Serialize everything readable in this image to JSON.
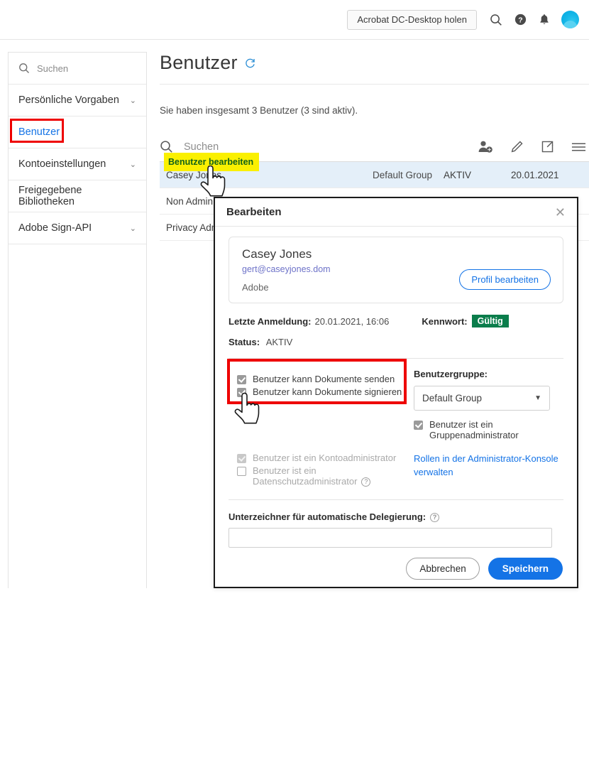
{
  "topbar": {
    "cta_label": "Acrobat DC-Desktop holen",
    "icons": [
      "search-icon",
      "help-icon",
      "bell-icon",
      "avatar"
    ]
  },
  "sidebar": {
    "search_placeholder": "Suchen",
    "items": [
      {
        "label": "Persönliche Vorgaben",
        "expandable": true,
        "active": false
      },
      {
        "label": "Benutzer",
        "expandable": false,
        "active": true
      },
      {
        "label": "Kontoeinstellungen",
        "expandable": true,
        "active": false
      },
      {
        "label": "Freigegebene Bibliotheken",
        "expandable": false,
        "active": false
      },
      {
        "label": "Adobe Sign-API",
        "expandable": true,
        "active": false
      }
    ],
    "chevron": "⌄"
  },
  "main": {
    "page_title": "Benutzer",
    "refresh_icon": "refresh-icon",
    "count_text": "Sie haben insgesamt 3 Benutzer (3 sind aktiv).",
    "list_search_placeholder": "Suchen",
    "toolbar_icons": [
      "add-user-icon",
      "edit-user-icon",
      "export-icon",
      "menu-icon"
    ],
    "tooltip": "Benutzer bearbeiten",
    "table": {
      "rows": [
        {
          "name": "Casey Jones",
          "group": "Default Group",
          "status": "AKTIV",
          "date": "20.01.2021",
          "selected": true
        },
        {
          "name": "Non Admin",
          "group": "",
          "status": "",
          "date": "",
          "selected": false
        },
        {
          "name": "Privacy Admin",
          "group": "",
          "status": "",
          "date": "",
          "selected": false
        }
      ]
    }
  },
  "modal": {
    "title": "Bearbeiten",
    "close_icon": "close-icon",
    "profile": {
      "name": "Casey Jones",
      "email": "gert@caseyjones.dom",
      "org": "Adobe",
      "edit_button": "Profil bearbeiten"
    },
    "last_login_label": "Letzte Anmeldung:",
    "last_login_value": "20.01.2021, 16:06",
    "password_label": "Kennwort:",
    "password_badge": "Gültig",
    "status_label": "Status:",
    "status_value": "AKTIV",
    "permissions": [
      {
        "label": "Benutzer kann Dokumente senden",
        "checked": true,
        "disabled": false
      },
      {
        "label": "Benutzer kann Dokumente signieren",
        "checked": true,
        "disabled": false
      }
    ],
    "group_label": "Benutzergruppe:",
    "group_value": "Default Group",
    "group_caret": "▼",
    "group_admin": {
      "label": "Benutzer ist ein Gruppenadministrator",
      "checked": true,
      "disabled": false
    },
    "admin_roles": [
      {
        "label": "Benutzer ist ein Kontoadministrator",
        "checked": true,
        "disabled": true,
        "help": false
      },
      {
        "label": "Benutzer ist ein Datenschutzadministrator",
        "checked": false,
        "disabled": true,
        "help": true
      }
    ],
    "roles_link": "Rollen in der Administrator-Konsole verwalten",
    "delegation_label": "Unterzeichner für automatische Delegierung:",
    "delegation_value": "",
    "delegation_help": true,
    "cancel_label": "Abbrechen",
    "save_label": "Speichern"
  },
  "annotations": {
    "highlight_color": "#ee0000",
    "tooltip_bg": "#faf000",
    "tooltip_fg": "#12621a",
    "accent_blue": "#1473e6",
    "badge_green": "#0a7d4b"
  }
}
